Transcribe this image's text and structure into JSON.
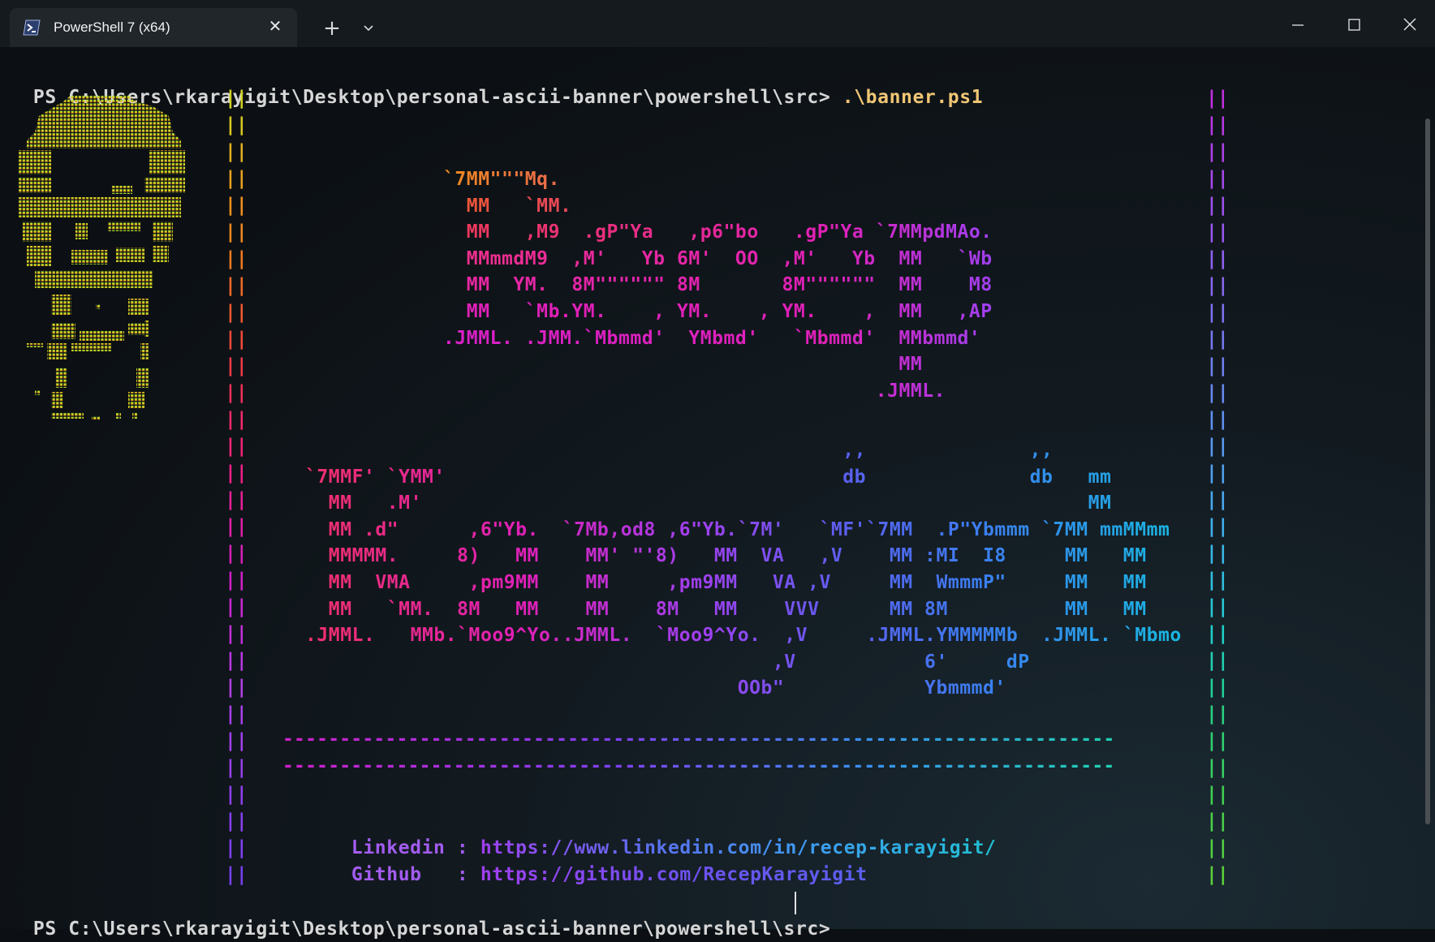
{
  "window": {
    "tab_title": "PowerShell 7 (x64)",
    "icons": [
      "powershell-icon",
      "close-icon",
      "plus-icon",
      "chevron-down-icon",
      "minimize-icon",
      "maximize-icon",
      "window-close-icon"
    ]
  },
  "terminal": {
    "prompt1": "PS C:\\Users\\rkarayigit\\Desktop\\personal-ascii-banner\\powershell\\src>",
    "command1": ".\\banner.ps1",
    "prompt2": "PS C:\\Users\\rkarayigit\\Desktop\\personal-ascii-banner\\powershell\\src>",
    "banner_recep": [
      "`7MM\"\"\"Mq.",
      "  MM   `MM.",
      "  MM   ,M9  .gP\"Ya   ,p6\"bo   .gP\"Ya `7MMpdMAo.",
      "  MMmmdM9  ,M'   Yb 6M'  OO  ,M'   Yb  MM   `Wb",
      "  MM  YM.  8M\"\"\"\"\"\" 8M       8M\"\"\"\"\"\"  MM    M8",
      "  MM   `Mb.YM.    , YM.    , YM.    ,  MM   ,AP",
      ".JMML. .JMM.`Mbmmd'  YMbmd'   `Mbmmd'  MMbmmd'",
      "                                       MM",
      "                                     .JMML."
    ],
    "banner_karayigit": [
      "                                              ,,              ,,",
      "`7MMF' `YMM'                                  db              db   mm",
      "  MM   .M'                                                         MM",
      "  MM .d\"      ,6\"Yb.  `7Mb,od8 ,6\"Yb.`7M'   `MF'`7MM  .P\"Ybmmm `7MM mmMMmm",
      "  MMMMM.     8)   MM    MM' \"'8)   MM  VA   ,V    MM :MI  I8     MM   MM",
      "  MM  VMA     ,pm9MM    MM     ,pm9MM   VA ,V     MM  WmmmP\"     MM   MM",
      "  MM   `MM.  8M   MM    MM    8M   MM    VVV      MM 8M          MM   MM",
      ".JMML.   MMb.`Moo9^Yo..JMML.  `Moo9^Yo.  ,V     .JMML.YMMMMMb  .JMML. `Mbmo",
      "                                        ,V           6'     dP",
      "                                     OOb\"            Ybmmmd'"
    ],
    "separator": "-------------------------------------------------------------------------",
    "links": [
      {
        "label": "Linkedin",
        "separator": " : ",
        "url": "https://www.linkedin.com/in/recep-karayigit/"
      },
      {
        "label": "Github  ",
        "separator": " : ",
        "url": "https://github.com/RecepKarayigit"
      }
    ],
    "border_char": "||"
  },
  "colors": {
    "orange": "#f08a1e",
    "red": "#f03a55",
    "magenta": "#e020b8",
    "purple": "#a040f0",
    "blue": "#3a70f0",
    "cyan": "#18b8e0",
    "green": "#40d040",
    "face_top": "#a8f030",
    "face_bottom": "#f09020"
  }
}
